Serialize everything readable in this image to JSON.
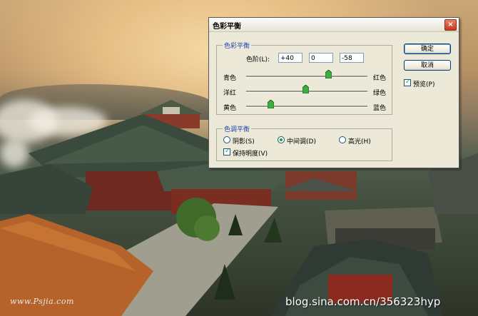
{
  "background": {
    "watermark_left": "www.Psjia.com",
    "watermark_right": "blog.sina.com.cn/356323hyp"
  },
  "dialog": {
    "title": "色彩平衡",
    "close_glyph": "×",
    "color_balance": {
      "legend": "色彩平衡",
      "levels_label": "色阶(L):",
      "levels": [
        "+40",
        "0",
        "-58"
      ],
      "sliders": [
        {
          "left": "青色",
          "right": "红色",
          "value": 40
        },
        {
          "left": "洋红",
          "right": "绿色",
          "value": 0
        },
        {
          "left": "黄色",
          "right": "蓝色",
          "value": -58
        }
      ]
    },
    "tone_balance": {
      "legend": "色调平衡",
      "options": [
        "阴影(S)",
        "中间调(D)",
        "高光(H)"
      ],
      "selected": "中间调(D)",
      "preserve_label": "保持明度(V)",
      "preserve_checked": true
    },
    "buttons": {
      "ok": "确定",
      "cancel": "取消"
    },
    "preview": {
      "label": "预览(P)",
      "checked": true
    }
  }
}
